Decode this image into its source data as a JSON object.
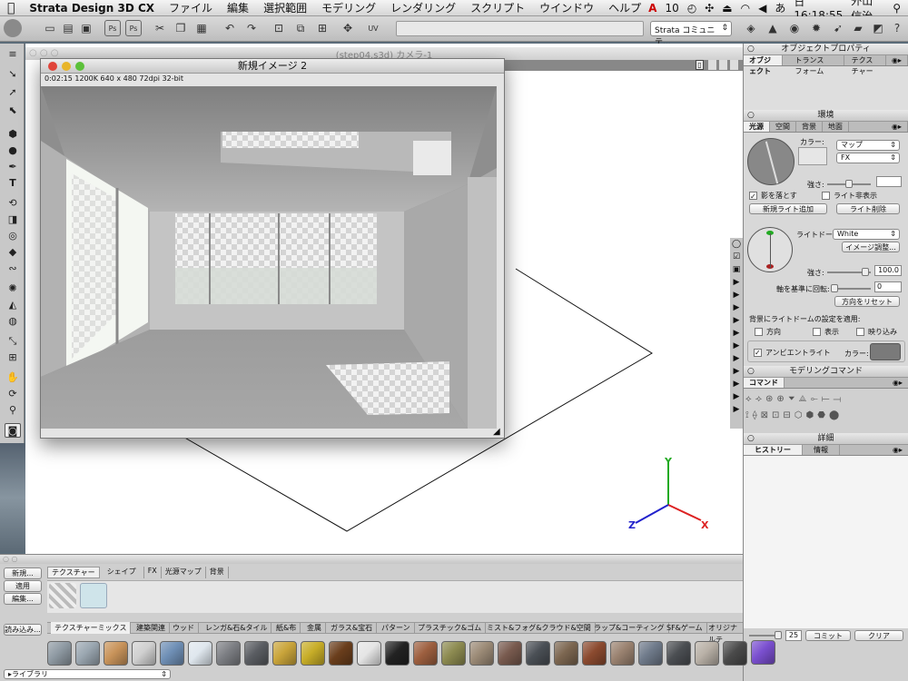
{
  "menubar": {
    "apple": "",
    "app_name": "Strata Design 3D CX",
    "items": [
      "ファイル",
      "編集",
      "選択範囲",
      "モデリング",
      "レンダリング",
      "スクリプト",
      "ウインドウ",
      "ヘルプ"
    ],
    "status_badge": "10",
    "clock": "日 16:18:55",
    "user": "外山 信治"
  },
  "toolbar": {
    "community_label": "Strata コミュニテ..."
  },
  "viewport": {
    "title": "(step04.s3d) カメラ-1",
    "axis_x": "X",
    "axis_y": "Y",
    "axis_z": "Z"
  },
  "render_window": {
    "title": "新規イメージ 2",
    "info": "0:02:15   1200K   640 x 480   72dpi   32-bit"
  },
  "object_props": {
    "title": "オブジェクトプロパティ",
    "tabs": [
      "オブジェクト",
      "トランスフォーム",
      "テクスチャー"
    ]
  },
  "environment": {
    "title": "環境",
    "tabs": [
      "光源",
      "空間",
      "背景",
      "地面"
    ],
    "color_label": "カラー:",
    "map_select": "マップ",
    "fx_select": "FX",
    "strength_label": "強さ:",
    "shadow_label": "影を落とす",
    "hide_light_label": "ライト非表示",
    "add_light_btn": "新規ライト追加",
    "delete_light_btn": "ライト削除",
    "light_dome_label": "ライトドーム:",
    "light_dome_value": "White",
    "image_adjust_btn": "イメージ調整...",
    "strength2_label": "強さ:",
    "strength2_value": "100.0",
    "axis_rotate_label": "軸を基準に回転:",
    "axis_rotate_value": "0",
    "reset_dir_btn": "方向をリセット",
    "apply_label": "背景にライトドームの設定を適用:",
    "dir_label": "方向",
    "show_label": "表示",
    "reflect_label": "映り込み",
    "ambient_label": "アンビエントライト",
    "ambient_color_label": "カラー:"
  },
  "modeling": {
    "title": "モデリングコマンド",
    "tab": "コマンド"
  },
  "details": {
    "title": "詳細",
    "tabs": [
      "ヒストリー",
      "情報"
    ],
    "count": "25",
    "commit_btn": "コミット",
    "clear_btn": "クリア"
  },
  "library": {
    "new_btn": "新規...",
    "apply_btn": "適用",
    "edit_btn": "編集...",
    "load_btn": "読み込み...",
    "library_select": "ライブラリ",
    "tabs": [
      "テクスチャー",
      "シェイプ",
      "FX",
      "光源マップ",
      "背景"
    ],
    "categories": [
      "テクスチャーミックス",
      "建築関連",
      "ウッド",
      "レンガ&石&タイル",
      "紙&布",
      "金属",
      "ガラス&宝石",
      "パターン",
      "プラスチック&ゴム",
      "ミスト&フォグ&クラウド&空間",
      "ラップ&コーティング",
      "SF&ゲーム",
      "オリジナルテ"
    ]
  },
  "swatch_colors": [
    "#8f9aa3",
    "#9aa6b0",
    "#c8935a",
    "#d0d0d0",
    "#6f8fb5",
    "#dfe7ee",
    "#7d7f84",
    "#5a5d62",
    "#c9a43a",
    "#c7ad28",
    "#6a3e1c",
    "#e5e5e5",
    "#222222",
    "#9d5f3f",
    "#8c8a50",
    "#9b8a76",
    "#785a4e",
    "#4a4f55",
    "#7c6650",
    "#8b4a2f",
    "#9a8270",
    "#6f7a8a",
    "#4b4e52",
    "#b8b0a6",
    "#4a4a4a",
    "#7a4fcf"
  ]
}
